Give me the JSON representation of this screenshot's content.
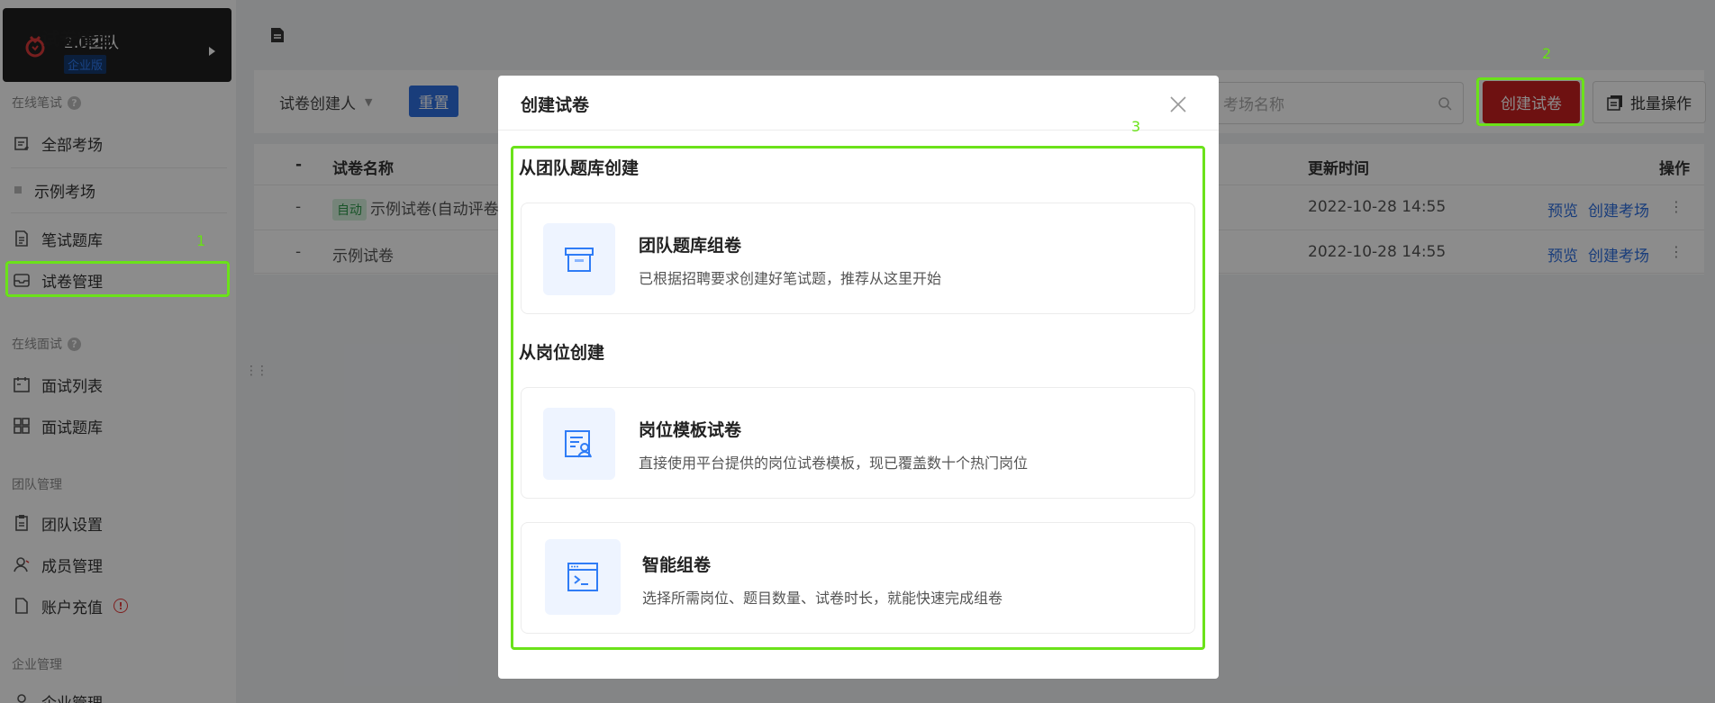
{
  "team": {
    "name": "2.0团队",
    "edition": "企业版"
  },
  "sidebar": {
    "sections": [
      {
        "title": "在线笔试"
      },
      {
        "title": "在线面试"
      },
      {
        "title": "团队管理"
      },
      {
        "title": "企业管理"
      }
    ],
    "items": [
      {
        "label": "全部考场"
      },
      {
        "label": "示例考场"
      },
      {
        "label": "笔试题库"
      },
      {
        "label": "试卷管理"
      },
      {
        "label": "面试列表"
      },
      {
        "label": "面试题库"
      },
      {
        "label": "团队设置"
      },
      {
        "label": "成员管理"
      },
      {
        "label": "账户充值"
      },
      {
        "label": "企业管理"
      }
    ]
  },
  "annotations": {
    "a1": "1",
    "a2": "2",
    "a3": "3"
  },
  "page": {
    "title": "试卷管理"
  },
  "filters": {
    "creator_label": "试卷创建人",
    "reset_label": "重置",
    "search_placeholder": "考场名称",
    "create_label": "创建试卷",
    "batch_label": "批量操作"
  },
  "table": {
    "headers": {
      "select": "-",
      "name": "试卷名称",
      "updated": "更新时间",
      "actions": "操作"
    },
    "rows": [
      {
        "select": "-",
        "tag": "自动",
        "name": "示例试卷(自动评卷",
        "updated": "2022-10-28 14:55",
        "preview": "预览",
        "create": "创建考场",
        "more": "⋮"
      },
      {
        "select": "-",
        "tag": "",
        "name": "示例试卷",
        "updated": "2022-10-28 14:55",
        "preview": "预览",
        "create": "创建考场",
        "more": "⋮"
      }
    ]
  },
  "modal": {
    "title": "创建试卷",
    "section_team": "从团队题库创建",
    "section_position": "从岗位创建",
    "cards": [
      {
        "title": "团队题库组卷",
        "desc": "已根据招聘要求创建好笔试题，推荐从这里开始",
        "icon": "archive-box-icon"
      },
      {
        "title": "岗位模板试卷",
        "desc": "直接使用平台提供的岗位试卷模板，现已覆盖数十个热门岗位",
        "icon": "resume-icon"
      },
      {
        "title": "智能组卷",
        "desc": "选择所需岗位、题目数量、试卷时长，就能快速完成组卷",
        "icon": "terminal-icon"
      }
    ]
  },
  "colors": {
    "accent": "#2f6fe0",
    "danger": "#c91f1f",
    "highlight": "#6be21a"
  }
}
